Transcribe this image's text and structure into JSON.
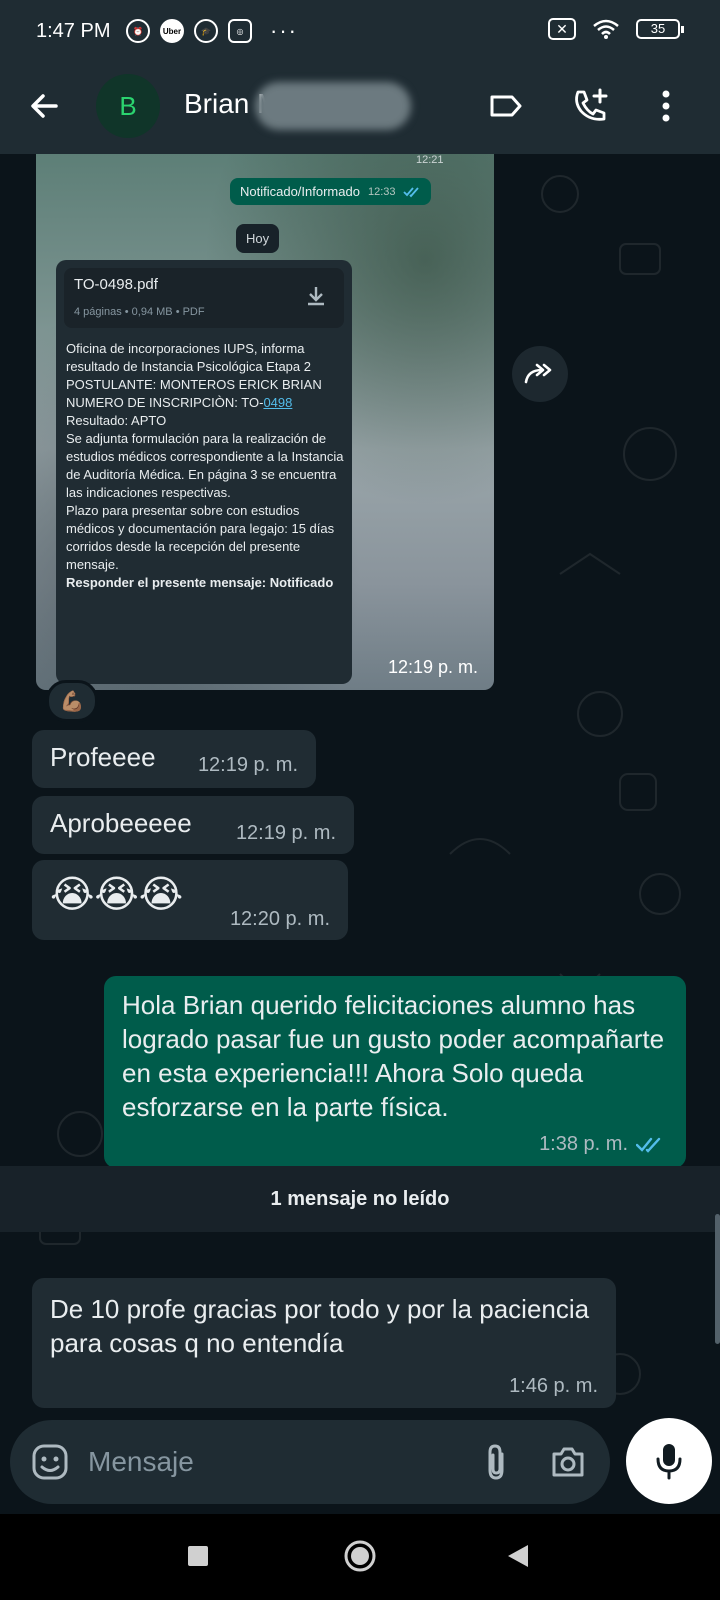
{
  "status_bar": {
    "time": "1:47 PM",
    "uber_label": "Uber",
    "dots": "···",
    "battery": "35"
  },
  "header": {
    "avatar_letter": "B",
    "contact_name": "Brian M"
  },
  "image_message": {
    "top_time": "12:21",
    "inner_out_text": "Notificado/Informado",
    "inner_out_time": "12:33",
    "date_chip": "Hoy",
    "doc_name": "TO-0498.pdf",
    "doc_meta": "4 páginas • 0,94 MB • PDF",
    "doc_body_1": "Oficina de incorporaciones IUPS, informa resultado de Instancia Psicológica Etapa 2",
    "doc_body_2": "POSTULANTE: MONTEROS ERICK BRIAN",
    "doc_body_3_prefix": "NUMERO DE INSCRIPCIÒN: TO-",
    "doc_body_3_link": "0498",
    "doc_body_4": "Resultado: APTO",
    "doc_body_5": "Se adjunta formulación para la realización de estudios médicos correspondiente a la Instancia de Auditoría Médica. En página 3 se encuentra las indicaciones respectivas.",
    "doc_body_6": "Plazo para presentar sobre con estudios médicos y documentación para legajo: 15 días corridos desde la recepción del presente mensaje.",
    "doc_body_7": "Responder el presente mensaje: Notificado",
    "time": "12:19 p. m."
  },
  "reaction": "💪🏽",
  "messages_in": [
    {
      "text": "Profeeee",
      "time": "12:19 p. m."
    },
    {
      "text": "Aprobeeeee",
      "time": "12:19 p. m."
    },
    {
      "text": "😭😭😭",
      "time": "12:20 p. m."
    }
  ],
  "message_out": {
    "text": "Hola Brian querido felicitaciones alumno has logrado pasar fue un gusto poder acompañarte en esta experiencia!!! Ahora Solo queda esforzarse en la parte física.",
    "time": "1:38 p. m."
  },
  "unread_banner": "1 mensaje no leído",
  "last_message": {
    "text": "De 10 profe gracias por todo y  por la paciencia para cosas q no entendía",
    "time": "1:46 p. m."
  },
  "input": {
    "placeholder": "Mensaje"
  },
  "colors": {
    "background": "#0b141a",
    "bar": "#1f2c33",
    "incoming": "#202c33",
    "outgoing": "#005c4b",
    "read_ticks": "#53bdeb",
    "avatar_text": "#2bd46f"
  },
  "icons": [
    "back-arrow-icon",
    "label-icon",
    "add-call-icon",
    "more-vert-icon",
    "download-icon",
    "forward-icon",
    "emoji-icon",
    "attach-icon",
    "camera-icon",
    "mic-icon",
    "recents-icon",
    "home-icon",
    "back-nav-icon"
  ]
}
